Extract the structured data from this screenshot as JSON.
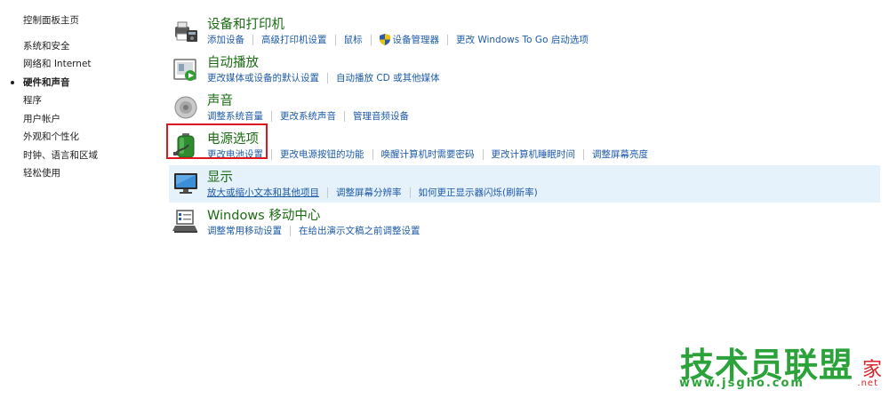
{
  "sidebar": {
    "home": "控制面板主页",
    "items": [
      {
        "label": "系统和安全"
      },
      {
        "label": "网络和 Internet"
      },
      {
        "label": "硬件和声音",
        "active": true
      },
      {
        "label": "程序"
      },
      {
        "label": "用户帐户"
      },
      {
        "label": "外观和个性化"
      },
      {
        "label": "时钟、语言和区域"
      },
      {
        "label": "轻松使用"
      }
    ]
  },
  "categories": [
    {
      "title": "设备和打印机",
      "icon": "printer-icon",
      "links": [
        "添加设备",
        "高级打印机设置",
        "鼠标",
        "设备管理器",
        "更改 Windows To Go 启动选项"
      ]
    },
    {
      "title": "自动播放",
      "icon": "autoplay-icon",
      "links": [
        "更改媒体或设备的默认设置",
        "自动播放 CD 或其他媒体"
      ]
    },
    {
      "title": "声音",
      "icon": "speaker-icon",
      "links": [
        "调整系统音量",
        "更改系统声音",
        "管理音频设备"
      ]
    },
    {
      "title": "电源选项",
      "icon": "battery-icon",
      "links": [
        "更改电池设置",
        "更改电源按钮的功能",
        "唤醒计算机时需要密码",
        "更改计算机睡眠时间",
        "调整屏幕亮度"
      ]
    },
    {
      "title": "显示",
      "icon": "monitor-icon",
      "links": [
        "放大或缩小文本和其他项目",
        "调整屏幕分辨率",
        "如何更正显示器闪烁(刷新率)"
      ]
    },
    {
      "title": "Windows 移动中心",
      "icon": "mobility-center-icon",
      "links": [
        "调整常用移动设置",
        "在给出演示文稿之前调整设置"
      ]
    }
  ],
  "watermark": {
    "main": "技术员联盟",
    "jia": "家",
    "url": "www.jsgho.com",
    "net": ".net"
  },
  "colors": {
    "category_title": "#1a6b12",
    "link": "#1d5aa8",
    "highlight": "#e5f1fb",
    "annotation_box": "#e0161d",
    "watermark_green": "#2ba33a",
    "watermark_red": "#d8242b"
  }
}
